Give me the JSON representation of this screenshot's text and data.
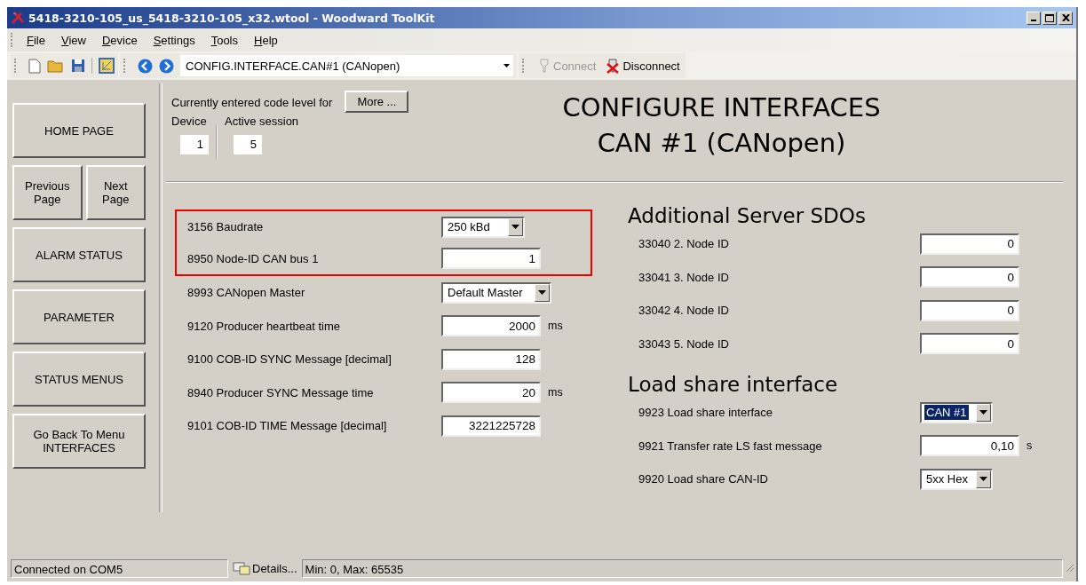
{
  "window": {
    "title": "5418-3210-105_us_5418-3210-105_x32.wtool - Woodward ToolKit"
  },
  "menu": [
    "File",
    "View",
    "Device",
    "Settings",
    "Tools",
    "Help"
  ],
  "toolbar": {
    "path": "CONFIG.INTERFACE.CAN#1 (CANopen)",
    "connect": {
      "label": "Connect",
      "disabled": true
    },
    "disconnect": {
      "label": "Disconnect",
      "disabled": false
    }
  },
  "sidebar": {
    "home": "HOME PAGE",
    "previous": "Previous Page",
    "next": "Next Page",
    "buttons": [
      "ALARM STATUS",
      "PARAMETER",
      "STATUS MENUS",
      "Go Back To Menu INTERFACES"
    ]
  },
  "code_level": {
    "caption": "Currently entered code level for",
    "more": "More ...",
    "device_label": "Device",
    "device_value": "1",
    "session_label": "Active session",
    "session_value": "5"
  },
  "page_title": [
    "CONFIGURE INTERFACES",
    "CAN #1 (CANopen)"
  ],
  "left_params": [
    {
      "label": "3156 Baudrate",
      "kind": "dropdown",
      "value": "250 kBd",
      "highlighted": true,
      "focused": false
    },
    {
      "label": "8950 Node-ID CAN bus 1",
      "kind": "number",
      "value": "1",
      "highlighted": true
    },
    {
      "label": "8993 CANopen Master",
      "kind": "dropdown",
      "value": "Default Master",
      "highlighted": false,
      "focused": false
    },
    {
      "label": "9120 Producer heartbeat time",
      "kind": "number",
      "value": "2000",
      "unit": "ms",
      "highlighted": false
    },
    {
      "label": "9100 COB-ID SYNC Message [decimal]",
      "kind": "number",
      "value": "128",
      "highlighted": false
    },
    {
      "label": "8940 Producer SYNC Message time",
      "kind": "number",
      "value": "20",
      "unit": "ms",
      "highlighted": false
    },
    {
      "label": "9101 COB-ID TIME Message [decimal]",
      "kind": "number",
      "value": "3221225728",
      "highlighted": false
    }
  ],
  "sections": [
    {
      "heading": "Additional Server SDOs",
      "params": [
        {
          "label": "33040 2. Node ID",
          "kind": "number",
          "value": "0"
        },
        {
          "label": "33041 3. Node ID",
          "kind": "number",
          "value": "0"
        },
        {
          "label": "33042 4. Node ID",
          "kind": "number",
          "value": "0"
        },
        {
          "label": "33043 5. Node ID",
          "kind": "number",
          "value": "0"
        }
      ]
    },
    {
      "heading": "Load share interface",
      "params": [
        {
          "label": "9923 Load share interface",
          "kind": "dropdown",
          "value": "CAN #1",
          "focused": true
        },
        {
          "label": "9921 Transfer rate LS fast message",
          "kind": "number",
          "value": "0,10",
          "unit": "s"
        },
        {
          "label": "9920 Load share CAN-ID",
          "kind": "dropdown",
          "value": "5xx Hex",
          "focused": false
        }
      ]
    }
  ],
  "status_bar": {
    "connection": "Connected on COM5",
    "details": "Details...",
    "range": "Min: 0, Max: 65535"
  }
}
